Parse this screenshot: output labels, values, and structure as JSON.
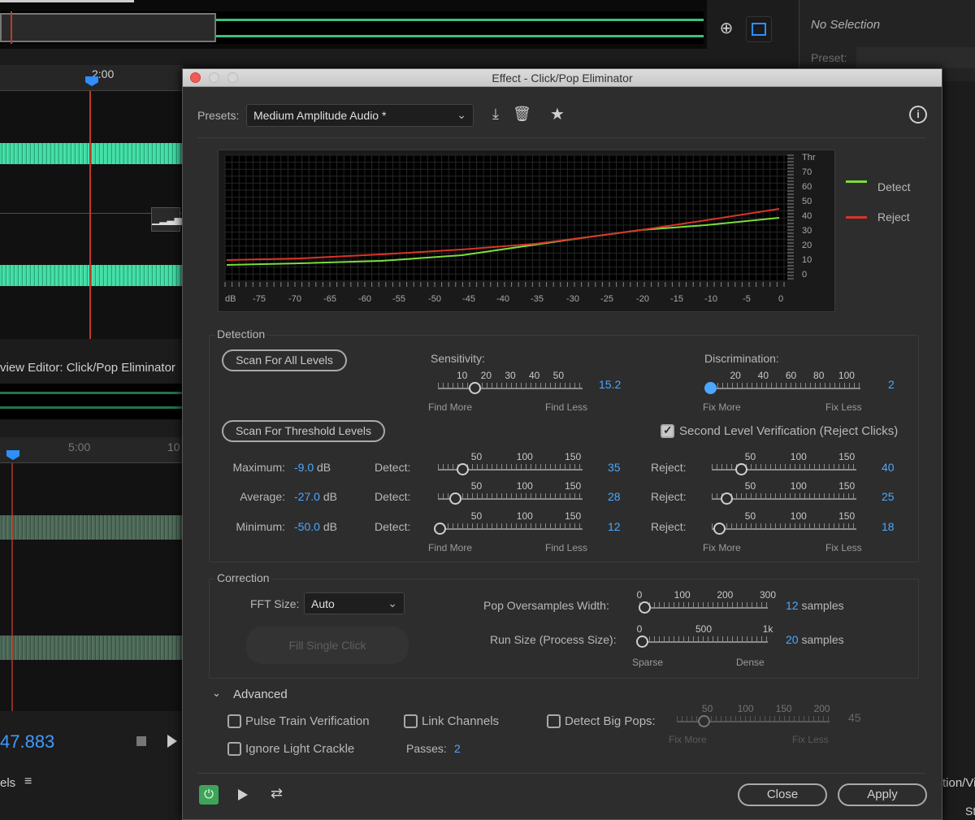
{
  "background": {
    "ruler_time": "2:00",
    "panel_title": "view Editor: Click/Pop Eliminator",
    "ruler2_time_a": "5:00",
    "ruler2_time_b": "10",
    "time_display": "47.883",
    "bottom_left_label": "els",
    "right_panel": {
      "no_selection": "No Selection",
      "preset_label": "Preset:"
    },
    "bottom_right_a": "tion/Vi",
    "bottom_right_b": "St"
  },
  "dialog": {
    "title": "Effect - Click/Pop Eliminator",
    "presets_label": "Presets:",
    "preset_value": "Medium Amplitude Audio *",
    "graph": {
      "right_axis_top": "Thr",
      "right_axis": [
        "70",
        "60",
        "50",
        "40",
        "30",
        "20",
        "10",
        "0"
      ],
      "x_axis": [
        "dB",
        "-75",
        "-70",
        "-65",
        "-60",
        "-55",
        "-50",
        "-45",
        "-40",
        "-35",
        "-30",
        "-25",
        "-20",
        "-15",
        "-10",
        "-5",
        "0"
      ],
      "legend": [
        {
          "name": "Detect",
          "color": "#7cdc3c"
        },
        {
          "name": "Reject",
          "color": "#d9342b"
        }
      ]
    },
    "detection": {
      "group_label": "Detection",
      "scan_all": "Scan For All Levels",
      "scan_threshold": "Scan For Threshold Levels",
      "sensitivity_label": "Sensitivity:",
      "sensitivity_ticks": [
        "10",
        "20",
        "30",
        "40",
        "50"
      ],
      "sensitivity_value": "15.2",
      "sens_left": "Find More",
      "sens_right": "Find Less",
      "discrimination_label": "Discrimination:",
      "disc_ticks": [
        "20",
        "40",
        "60",
        "80",
        "100"
      ],
      "disc_value": "2",
      "disc_left": "Fix More",
      "disc_right": "Fix Less",
      "second_level": "Second Level Verification (Reject Clicks)",
      "slider_ticks": [
        "50",
        "100",
        "150"
      ],
      "rows": [
        {
          "label": "Maximum:",
          "value": "-9.0",
          "unit": "dB",
          "detect_label": "Detect:",
          "detect": "35",
          "reject_label": "Reject:",
          "reject": "40"
        },
        {
          "label": "Average:",
          "value": "-27.0",
          "unit": "dB",
          "detect_label": "Detect:",
          "detect": "28",
          "reject_label": "Reject:",
          "reject": "25"
        },
        {
          "label": "Minimum:",
          "value": "-50.0",
          "unit": "dB",
          "detect_label": "Detect:",
          "detect": "12",
          "reject_label": "Reject:",
          "reject": "18"
        }
      ],
      "bottom_find_more": "Find More",
      "bottom_find_less": "Find Less",
      "bottom_fix_more": "Fix More",
      "bottom_fix_less": "Fix Less"
    },
    "correction": {
      "group_label": "Correction",
      "fft_label": "FFT Size:",
      "fft_value": "Auto",
      "fill_single": "Fill Single Click",
      "pop_label": "Pop Oversamples Width:",
      "pop_ticks": [
        "0",
        "100",
        "200",
        "300"
      ],
      "pop_value": "12",
      "pop_unit": "samples",
      "run_label": "Run Size (Process Size):",
      "run_ticks": [
        "0",
        "500",
        "1k"
      ],
      "run_value": "20",
      "run_unit": "samples",
      "run_left": "Sparse",
      "run_right": "Dense"
    },
    "advanced": {
      "label": "Advanced",
      "pulse_train": "Pulse Train Verification",
      "link_channels": "Link Channels",
      "detect_big_pops": "Detect Big Pops:",
      "big_pops_ticks": [
        "50",
        "100",
        "150",
        "200"
      ],
      "big_pops_value": "45",
      "big_left": "Fix More",
      "big_right": "Fix Less",
      "ignore_crackle": "Ignore Light Crackle",
      "passes_label": "Passes:",
      "passes_value": "2"
    },
    "footer": {
      "close": "Close",
      "apply": "Apply"
    }
  }
}
